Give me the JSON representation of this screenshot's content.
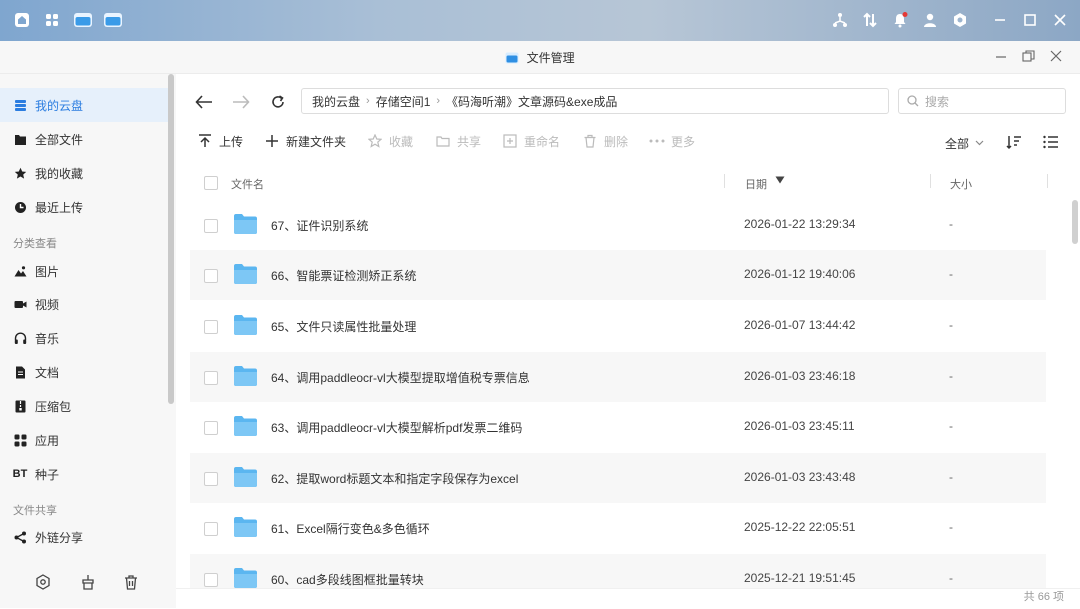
{
  "app": {
    "title": "文件管理"
  },
  "sidebar": {
    "items": [
      {
        "label": "我的云盘",
        "icon": "cloud-list-icon"
      },
      {
        "label": "全部文件",
        "icon": "file-icon"
      },
      {
        "label": "我的收藏",
        "icon": "star-icon"
      },
      {
        "label": "最近上传",
        "icon": "clock-icon"
      }
    ],
    "section_category": "分类查看",
    "category_items": [
      {
        "label": "图片",
        "icon": "image-icon"
      },
      {
        "label": "视频",
        "icon": "video-icon"
      },
      {
        "label": "音乐",
        "icon": "headphones-icon"
      },
      {
        "label": "文档",
        "icon": "document-icon"
      },
      {
        "label": "压缩包",
        "icon": "archive-icon"
      },
      {
        "label": "应用",
        "icon": "apps-icon"
      },
      {
        "label": "种子",
        "icon_text": "BT"
      }
    ],
    "section_share": "文件共享",
    "share_items": [
      {
        "label": "外链分享",
        "icon": "share-icon"
      }
    ]
  },
  "breadcrumb": {
    "items": [
      "我的云盘",
      "存储空间1",
      "《码海听潮》文章源码&exe成品"
    ]
  },
  "search": {
    "placeholder": "搜索"
  },
  "toolbar": {
    "upload": "上传",
    "new_folder": "新建文件夹",
    "favorite": "收藏",
    "share": "共享",
    "rename": "重命名",
    "delete": "删除",
    "more": "更多",
    "filter": "全部"
  },
  "table": {
    "headers": {
      "name": "文件名",
      "date": "日期",
      "size": "大小"
    },
    "rows": [
      {
        "name": "67、证件识别系统",
        "date": "2026-01-22 13:29:34",
        "size": "-"
      },
      {
        "name": "66、智能票证检测矫正系统",
        "date": "2026-01-12 19:40:06",
        "size": "-"
      },
      {
        "name": "65、文件只读属性批量处理",
        "date": "2026-01-07 13:44:42",
        "size": "-"
      },
      {
        "name": "64、调用paddleocr-vl大模型提取增值税专票信息",
        "date": "2026-01-03 23:46:18",
        "size": "-"
      },
      {
        "name": "63、调用paddleocr-vl大模型解析pdf发票二维码",
        "date": "2026-01-03 23:45:11",
        "size": "-"
      },
      {
        "name": "62、提取word标题文本和指定字段保存为excel",
        "date": "2026-01-03 23:43:48",
        "size": "-"
      },
      {
        "name": "61、Excel隔行变色&多色循环",
        "date": "2025-12-22 22:05:51",
        "size": "-"
      },
      {
        "name": "60、cad多段线图框批量转块",
        "date": "2025-12-21 19:51:45",
        "size": "-"
      }
    ]
  },
  "footer": {
    "count": "共 66 项"
  },
  "colors": {
    "accent": "#2b7de0",
    "folder": "#5bb6f0"
  }
}
